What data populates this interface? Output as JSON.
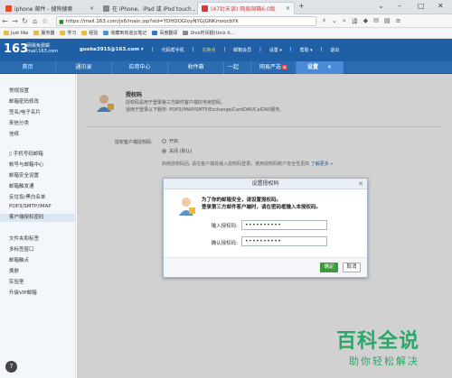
{
  "browser": {
    "tabs": [
      {
        "label": "iphone 邮件 - 搜狗搜索",
        "color": "#e04b2c"
      },
      {
        "label": "在 iPhone、iPad 或 iPod touch 上...",
        "color": "#999999"
      },
      {
        "label": "(47封未读) 网易邮箱6.0版",
        "color": "#d33a3a"
      }
    ],
    "url": "https://mail.163.com/js6/main.jsp?sid=YDHDOGloyNYGjGNKmoocbYk",
    "bookmarks": [
      "Just like",
      "服务器",
      "学习",
      "经验",
      "收藏到有道云笔记",
      "百度翻译",
      "Unix时间戳(Unix ti..."
    ]
  },
  "mail": {
    "logo": "163",
    "logo_sub": "网易免费邮 mail.163.com",
    "account": "guoke3915@163.com ▾",
    "top_menu": [
      "|",
      "代码帮手机",
      "|",
      "兑换点",
      "|",
      "邮箱会员",
      "|",
      "设置 ▾",
      "|",
      "帮助 ▾",
      "|",
      "退出"
    ],
    "nav_tabs": [
      "首页",
      "通讯录",
      "应用中心",
      "收件箱",
      "一起",
      "网易严选",
      "设置"
    ],
    "nav_badge": "新",
    "sidebar": [
      "常规设置",
      "邮箱密码修改",
      "签名/电子名片",
      "来信分类",
      "信纸",
      "手机号码邮箱",
      "帐号与邮箱中心",
      "邮箱安全设置",
      "邮箱触发通",
      "反垃圾/黑白名单",
      "POP3/SMTP/IMAP",
      "客户端授权密码",
      "文件夹和标签",
      "多标签窗口",
      "邮箱触点",
      "换肤",
      "实验室",
      "升级VIP邮箱"
    ],
    "section": {
      "title": "授权码",
      "desc1": "授权码是用于登录第三方邮件客户端的专用密码。",
      "desc2": "适用于登录以下服务: POP3/IMAP/SMTP/Exchange/CardDAV/CalDAV服务。",
      "auth_label": "授权客户端授权码:",
      "opt_on": "开启",
      "opt_off": "关闭 (默认)",
      "note": "启用授权码后, 请在客户端处输入授权码登录。使用授权码帐户安全性更高",
      "note_link": "了解更多 »"
    },
    "dialog": {
      "title": "设置授权码",
      "close": "✕",
      "msg1": "为了你的邮箱安全，请设置授权码。",
      "msg2": "登录第三方邮件客户端时，请在密码框输入本授权码。",
      "lbl1": "输入授权码:",
      "val1": "••••••••••",
      "lbl2": "确认授权码:",
      "val2": "••••••••••",
      "ok": "确定",
      "cancel": "取消"
    }
  },
  "watermark": {
    "big": "百科全说",
    "small": "助你轻松解决"
  },
  "help_icon": "?"
}
